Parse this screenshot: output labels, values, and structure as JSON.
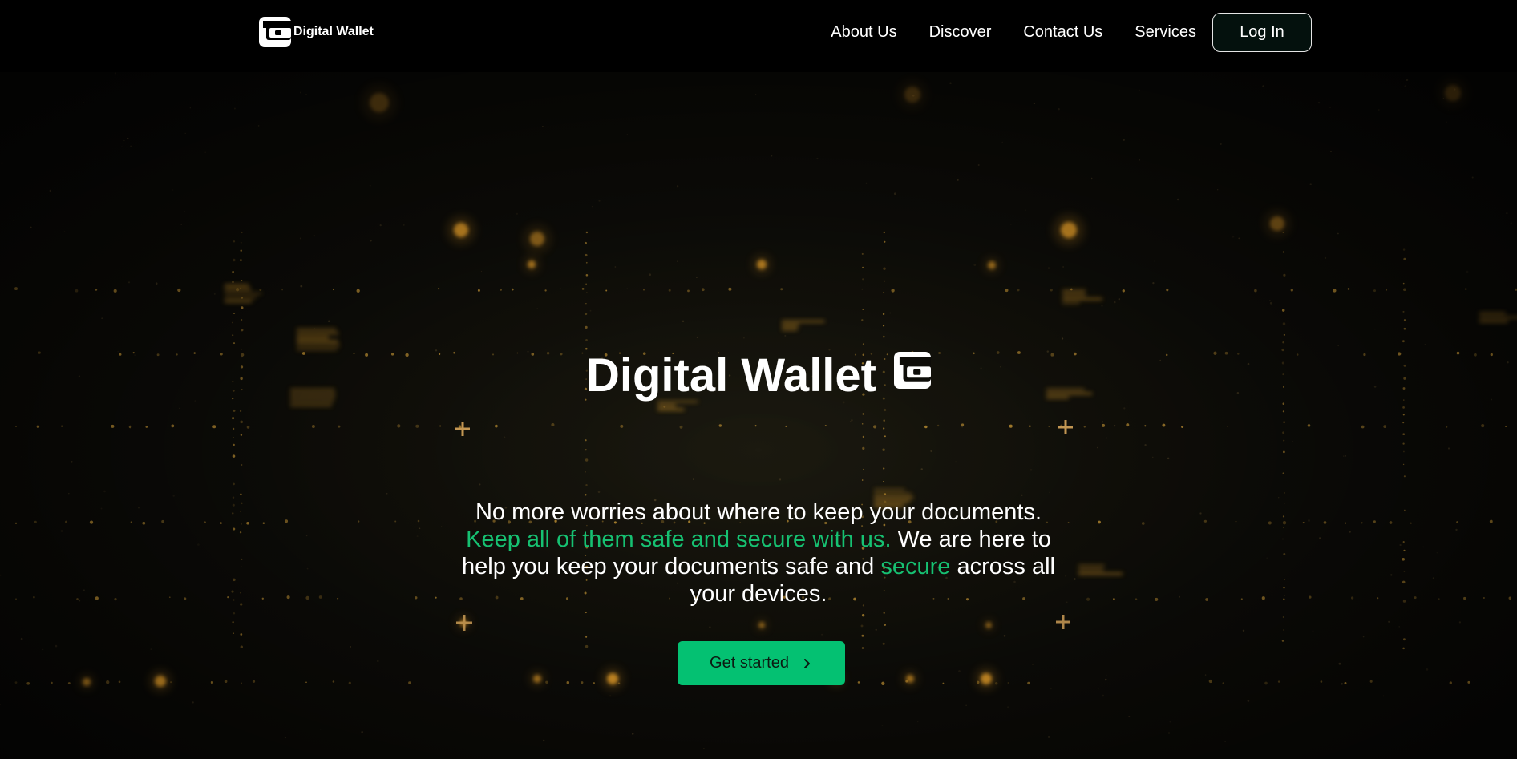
{
  "brand": {
    "name": "Digital Wallet",
    "icon": "wallet-icon"
  },
  "nav": {
    "links": [
      {
        "label": "About Us"
      },
      {
        "label": "Discover"
      },
      {
        "label": "Contact Us"
      },
      {
        "label": "Services"
      }
    ],
    "login_label": "Log In"
  },
  "hero": {
    "title": "Digital Wallet",
    "title_icon": "wallet-icon",
    "subtitle": {
      "part1": "No more worries about where to keep your documents. ",
      "highlight1": "Keep all of them safe and secure with us.",
      "part2": " We are here to help you keep your documents safe and ",
      "highlight2": "secure",
      "part3": " across all your devices."
    },
    "cta_label": "Get started",
    "cta_icon": "chevron-right-icon"
  },
  "colors": {
    "accent": "#04c172",
    "highlight_text": "#16c172",
    "background": "#000000",
    "bokeh": "#f5a623"
  }
}
